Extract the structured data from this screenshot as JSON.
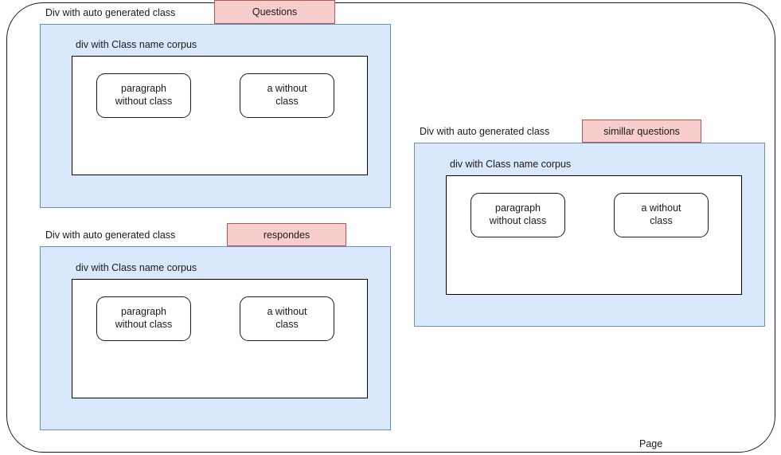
{
  "diagram": {
    "page": {
      "label": "Page"
    },
    "colors": {
      "blue_fill": "#dae8fc",
      "blue_stroke": "#6c8ebf",
      "pink_fill": "#f8cecc",
      "pink_stroke": "#b85450",
      "node_stroke": "#1a1a1a",
      "white_fill": "#ffffff"
    },
    "groups": [
      {
        "id": "questions",
        "auto_class_label": "Div with auto generated class",
        "tag_label": "Questions",
        "corpus_label": "div with Class name corpus",
        "nodes": [
          {
            "line1": "paragraph",
            "line2": "without class"
          },
          {
            "line1": "a without",
            "line2": "class"
          }
        ]
      },
      {
        "id": "respondes",
        "auto_class_label": "Div with auto generated class",
        "tag_label": "respondes",
        "corpus_label": "div with Class name corpus",
        "nodes": [
          {
            "line1": "paragraph",
            "line2": "without class"
          },
          {
            "line1": "a without",
            "line2": "class"
          }
        ]
      },
      {
        "id": "similar",
        "auto_class_label": "Div with auto generated class",
        "tag_label": "simillar questions",
        "corpus_label": "div with Class name corpus",
        "nodes": [
          {
            "line1": "paragraph",
            "line2": "without class"
          },
          {
            "line1": "a without",
            "line2": "class"
          }
        ]
      }
    ]
  }
}
